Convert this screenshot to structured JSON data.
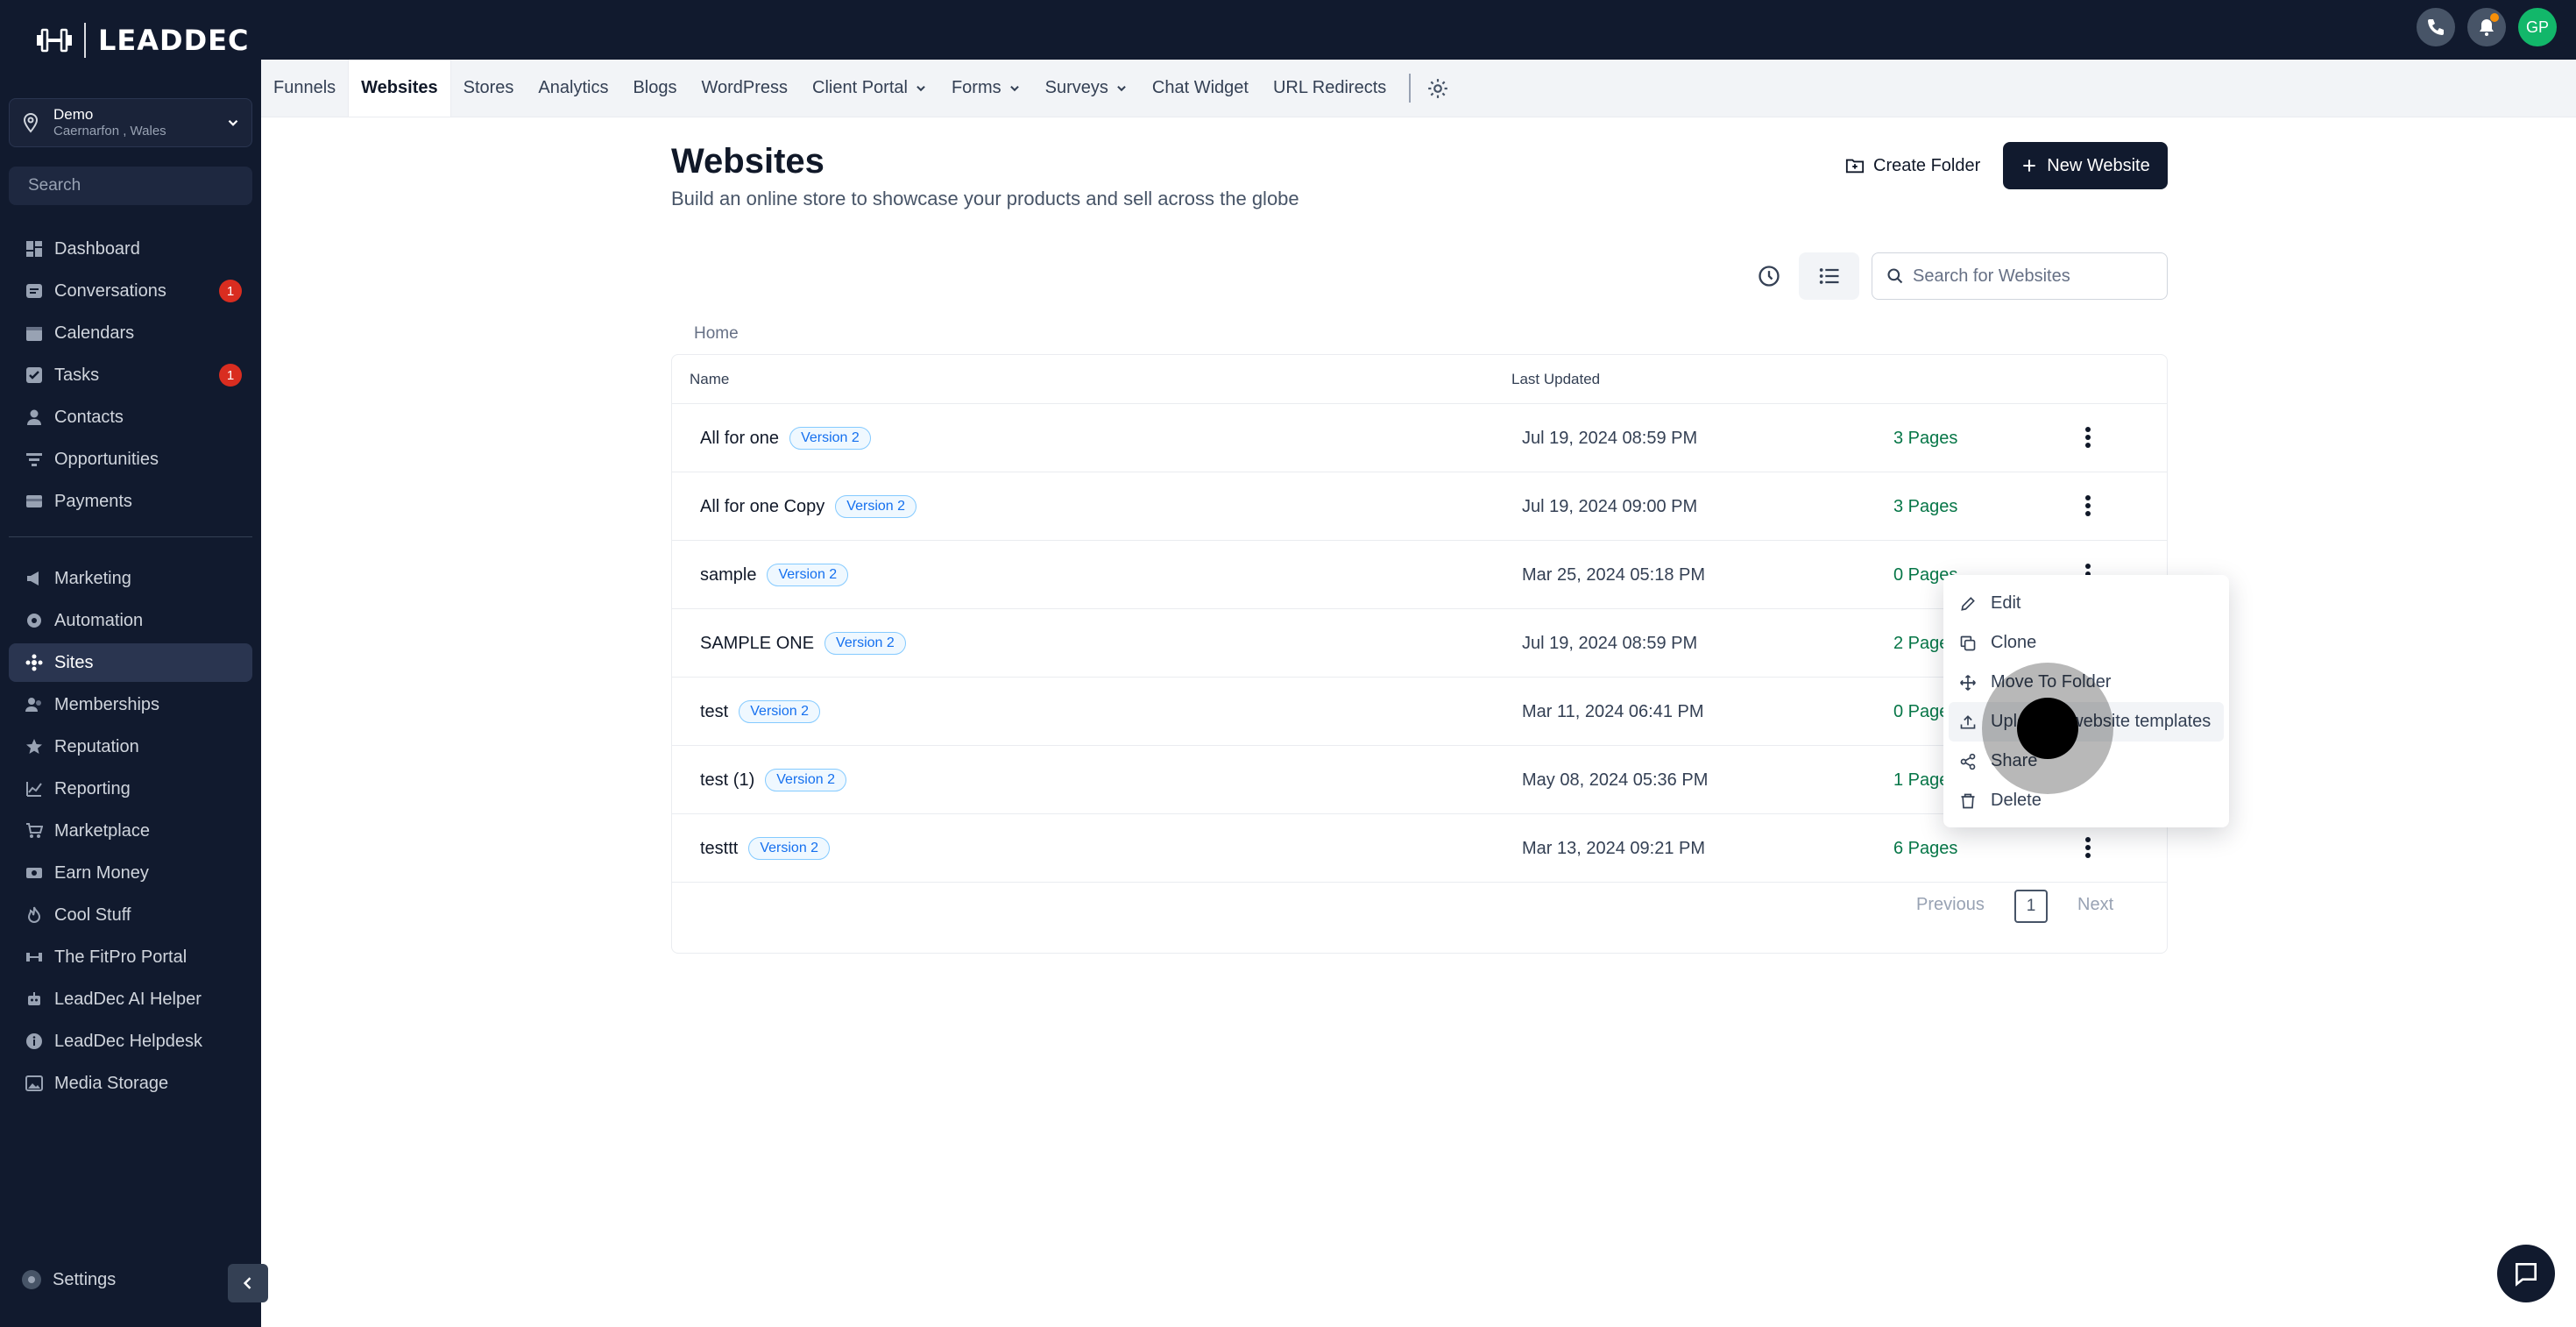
{
  "brand": {
    "name": "LEADDEC"
  },
  "account": {
    "name": "Demo",
    "location": "Caernarfon , Wales"
  },
  "sidebar": {
    "search_placeholder": "Search",
    "items": [
      {
        "label": "Dashboard",
        "icon": "dashboard-icon"
      },
      {
        "label": "Conversations",
        "icon": "chat-icon",
        "count": "1"
      },
      {
        "label": "Calendars",
        "icon": "calendar-icon"
      },
      {
        "label": "Tasks",
        "icon": "check-icon",
        "count": "1"
      },
      {
        "label": "Contacts",
        "icon": "user-icon"
      },
      {
        "label": "Opportunities",
        "icon": "filter-icon"
      },
      {
        "label": "Payments",
        "icon": "card-icon"
      }
    ],
    "items2": [
      {
        "label": "Marketing",
        "icon": "megaphone-icon"
      },
      {
        "label": "Automation",
        "icon": "automation-icon"
      },
      {
        "label": "Sites",
        "icon": "sites-icon",
        "active": true
      },
      {
        "label": "Memberships",
        "icon": "memberships-icon"
      },
      {
        "label": "Reputation",
        "icon": "star-icon"
      },
      {
        "label": "Reporting",
        "icon": "chart-icon"
      },
      {
        "label": "Marketplace",
        "icon": "cart-icon"
      },
      {
        "label": "Earn Money",
        "icon": "money-icon"
      },
      {
        "label": "Cool Stuff",
        "icon": "flame-icon"
      },
      {
        "label": "The FitPro Portal",
        "icon": "dumbbell-icon"
      },
      {
        "label": "LeadDec AI Helper",
        "icon": "robot-icon"
      },
      {
        "label": "LeadDec Helpdesk",
        "icon": "info-icon"
      },
      {
        "label": "Media Storage",
        "icon": "image-icon"
      }
    ],
    "settings": "Settings"
  },
  "topbar": {
    "avatar": "GP"
  },
  "tabs": [
    {
      "label": "Funnels"
    },
    {
      "label": "Websites",
      "active": true
    },
    {
      "label": "Stores"
    },
    {
      "label": "Analytics"
    },
    {
      "label": "Blogs"
    },
    {
      "label": "WordPress"
    },
    {
      "label": "Client Portal",
      "dropdown": true
    },
    {
      "label": "Forms",
      "dropdown": true
    },
    {
      "label": "Surveys",
      "dropdown": true
    },
    {
      "label": "Chat Widget"
    },
    {
      "label": "URL Redirects"
    }
  ],
  "main": {
    "title": "Websites",
    "subtitle": "Build an online store to showcase your products and sell across the globe",
    "create_folder": "Create Folder",
    "new_website": "New Website",
    "search_placeholder": "Search for Websites",
    "breadcrumb": "Home"
  },
  "table": {
    "col_name": "Name",
    "col_updated": "Last Updated",
    "rows": [
      {
        "name": "All for one",
        "version": "Version 2",
        "updated": "Jul 19, 2024 08:59 PM",
        "pages": "3 Pages"
      },
      {
        "name": "All for one Copy",
        "version": "Version 2",
        "updated": "Jul 19, 2024 09:00 PM",
        "pages": "3 Pages"
      },
      {
        "name": "sample",
        "version": "Version 2",
        "updated": "Mar 25, 2024 05:18 PM",
        "pages": "0 Pages"
      },
      {
        "name": "SAMPLE ONE",
        "version": "Version 2",
        "updated": "Jul 19, 2024 08:59 PM",
        "pages": "2 Pages"
      },
      {
        "name": "test",
        "version": "Version 2",
        "updated": "Mar 11, 2024 06:41 PM",
        "pages": "0 Pages"
      },
      {
        "name": "test (1)",
        "version": "Version 2",
        "updated": "May 08, 2024 05:36 PM",
        "pages": "1 Pages"
      },
      {
        "name": "testtt",
        "version": "Version 2",
        "updated": "Mar 13, 2024 09:21 PM",
        "pages": "6 Pages"
      }
    ],
    "pager": {
      "previous": "Previous",
      "page": "1",
      "next": "Next"
    }
  },
  "menu": {
    "items": [
      {
        "label": "Edit",
        "icon": "pencil-icon"
      },
      {
        "label": "Clone",
        "icon": "copy-icon"
      },
      {
        "label": "Move To Folder",
        "icon": "move-icon"
      },
      {
        "label": "Upload to website templates",
        "icon": "upload-icon",
        "hover": true
      },
      {
        "label": "Share",
        "icon": "share-icon"
      },
      {
        "label": "Delete",
        "icon": "trash-icon"
      }
    ]
  },
  "colors": {
    "sidebar_bg": "#111a2e",
    "accent_green": "#067647",
    "badge_blue": "#1570ef",
    "alert_red": "#d92d20"
  }
}
